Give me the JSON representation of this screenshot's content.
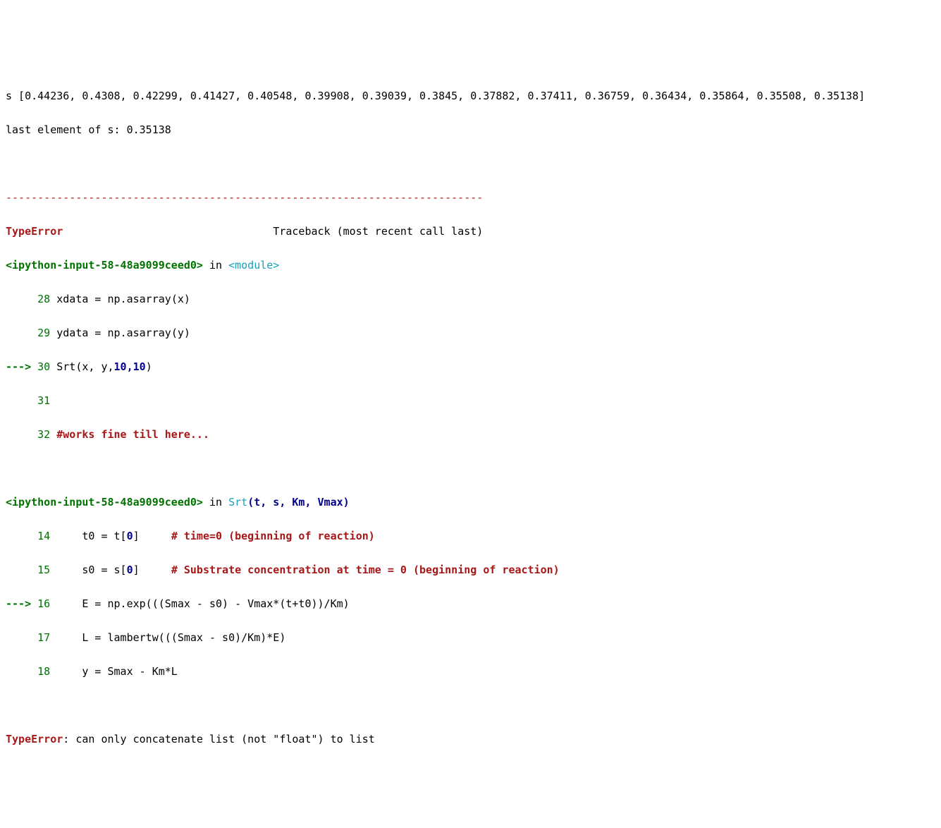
{
  "output": {
    "s_list": "s [0.44236, 0.4308, 0.42299, 0.41427, 0.40548, 0.39908, 0.39039, 0.3845, 0.37882, 0.37411, 0.36759, 0.36434, 0.35864, 0.35508, 0.35138]",
    "last_element": "last element of s: 0.35138"
  },
  "traceback": {
    "separator": "---------------------------------------------------------------------------",
    "error_type": "TypeError",
    "traceback_label": "Traceback (most recent call last)",
    "frame1": {
      "source": "<ipython-input-58-48a9099ceed0>",
      "in_word": " in ",
      "module": "<module>",
      "l28": {
        "n": "     28 ",
        "prefix": "xdata = np",
        "dot": ".",
        "fn": "asarray",
        "call": "(x)"
      },
      "l29": {
        "n": "     29 ",
        "prefix": "ydata = np",
        "dot": ".",
        "fn": "asarray",
        "call": "(y)"
      },
      "arrow": "---> ",
      "l30": {
        "n": "30 ",
        "call": "Srt(x, y,",
        "args_bold": "10,10",
        "tail": ")"
      },
      "l31": {
        "n": "     31 ",
        "blank": ""
      },
      "l32": {
        "n": "     32 ",
        "comment": "#works fine till here..."
      }
    },
    "frame2": {
      "source": "<ipython-input-58-48a9099ceed0>",
      "in_word": " in ",
      "fn": "Srt",
      "sig": "(t, s, Km, Vmax)",
      "l14": {
        "n": "     14 ",
        "code": "    t0 = t[",
        "idx": "0",
        "br": "]     ",
        "comment": "# time=0 (beginning of reaction)"
      },
      "l15": {
        "n": "     15 ",
        "code": "    s0 = s[",
        "idx": "0",
        "br": "]     ",
        "comment": "# Substrate concentration at time = 0 (beginning of reaction)"
      },
      "arrow": "---> ",
      "l16": {
        "n": "16 ",
        "code": "    E = np.exp(((Smax - s0) - Vmax*(t+t0))/Km)"
      },
      "l17": {
        "n": "     17 ",
        "code": "    L = lambertw(((Smax - s0)/Km)*E)"
      },
      "l18": {
        "n": "     18 ",
        "code": "    y = Smax - Km*L"
      }
    },
    "final": {
      "error_type": "TypeError",
      "msg": ": can only concatenate list (not \"float\") to list"
    }
  }
}
